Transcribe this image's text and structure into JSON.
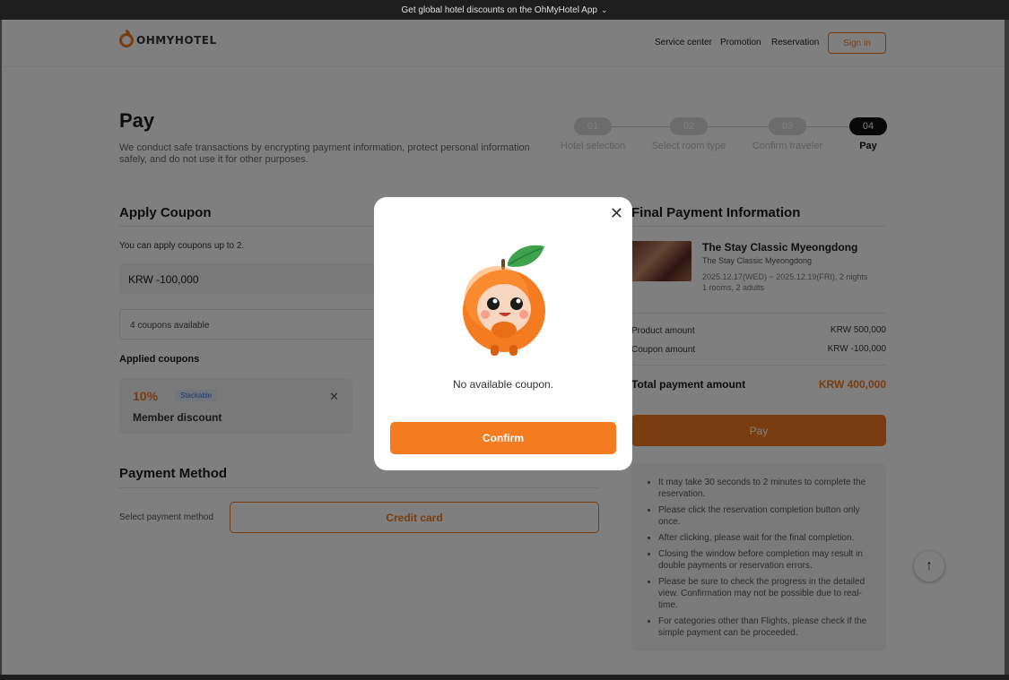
{
  "topbar": {
    "text": "Get global hotel discounts on the OhMyHotel App",
    "chevron": "chevron-down-icon"
  },
  "header": {
    "logo": "OHMYHOTEL",
    "nav": [
      "Service center",
      "Promotion",
      "Reservation"
    ],
    "signin": "Sign in"
  },
  "page": {
    "title": "Pay",
    "subtitle": "We conduct safe transactions by encrypting payment information, protect personal information safely, and do not use it for other purposes."
  },
  "steps": [
    {
      "num": "01",
      "label": "Hotel selection"
    },
    {
      "num": "02",
      "label": "Select room type"
    },
    {
      "num": "03",
      "label": "Confirm traveler"
    },
    {
      "num": "04",
      "label": "Pay"
    }
  ],
  "coupon": {
    "title": "Apply Coupon",
    "hint": "You can apply coupons up to 2.",
    "amount": "KRW -100,000",
    "available": "4 coupons available",
    "applied_title": "Applied coupons",
    "card": {
      "percent": "10%",
      "badge": "Stackable",
      "name": "Member discount",
      "close": "✕"
    }
  },
  "payment": {
    "title": "Payment Method",
    "label": "Select payment method",
    "method": "Credit card"
  },
  "summary": {
    "title": "Final Payment Information",
    "hotel_name": "The Stay Classic Myeongdong",
    "hotel_sub": "The Stay Classic Myeongdong",
    "dates": "2025.12.17(WED) ~ 2025.12.19(FRI), 2 nights",
    "guests": "1 rooms, 2 adults",
    "product_label": "Product amount",
    "product_value": "KRW 500,000",
    "coupon_label": "Coupon amount",
    "coupon_value": "KRW -100,000",
    "total_label": "Total payment amount",
    "total_value": "KRW 400,000",
    "pay_button": "Pay"
  },
  "notices": [
    "It may take 30 seconds to 2 minutes to complete the reservation.",
    "Please click the reservation completion button only once.",
    "After clicking, please wait for the final completion.",
    "Closing the window before completion may result in double payments or reservation errors.",
    "Please be sure to check the progress in the detailed view. Confirmation may not be possible due to real-time.",
    "For categories other than Flights, please check if the simple payment can be proceeded."
  ],
  "modal": {
    "message": "No available coupon.",
    "confirm": "Confirm",
    "close_icon": "close-icon",
    "mascot": "orange-mascot-icon"
  },
  "colors": {
    "accent": "#f47b20",
    "badge_bg": "#e3ecfb",
    "badge_text": "#3b6fd8"
  }
}
